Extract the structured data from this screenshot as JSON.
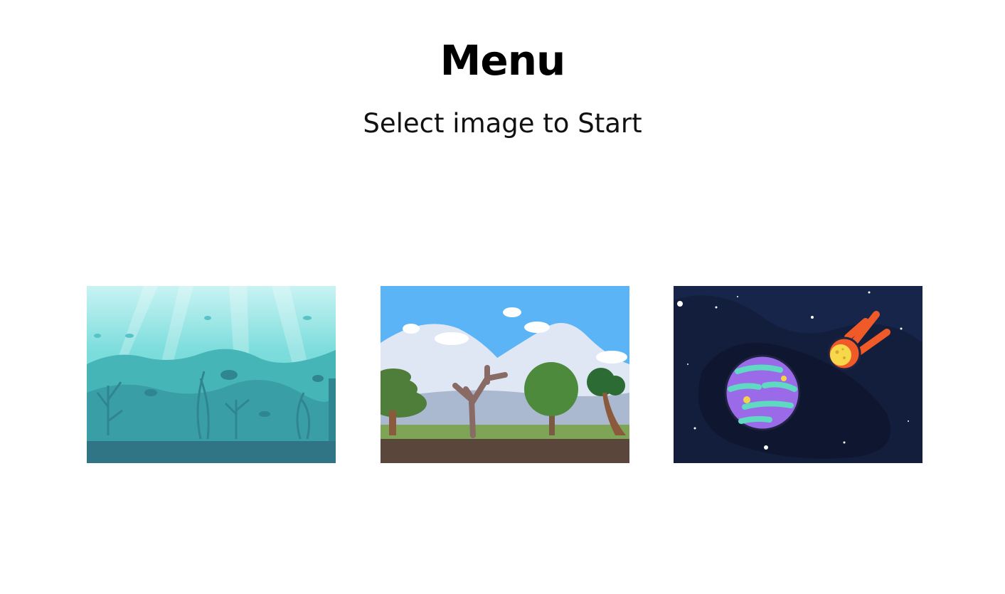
{
  "header": {
    "title": "Menu",
    "subtitle": "Select image to Start"
  },
  "scenes": [
    {
      "name": "ocean",
      "icon": "underwater-scene"
    },
    {
      "name": "forest",
      "icon": "forest-scene"
    },
    {
      "name": "space",
      "icon": "space-scene"
    }
  ],
  "colors": {
    "ocean_water": "#5fd3d3",
    "ocean_floor": "#2f7585",
    "forest_sky": "#5ab4f5",
    "forest_ground": "#5a463b",
    "space_bg": "#17254a"
  }
}
